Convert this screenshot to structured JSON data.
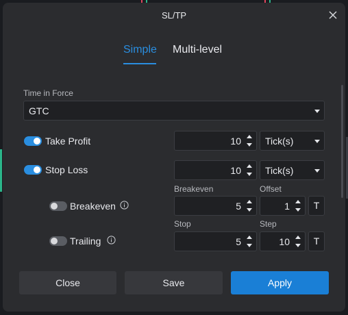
{
  "dialog": {
    "title": "SL/TP"
  },
  "tabs": [
    {
      "label": "Simple",
      "active": true
    },
    {
      "label": "Multi-level",
      "active": false
    }
  ],
  "time_in_force": {
    "label": "Time in Force",
    "value": "GTC"
  },
  "take_profit": {
    "label": "Take Profit",
    "enabled": true,
    "value": "10",
    "unit": "Tick(s)"
  },
  "stop_loss": {
    "label": "Stop Loss",
    "enabled": true,
    "value": "10",
    "unit": "Tick(s)"
  },
  "breakeven": {
    "label": "Breakeven",
    "enabled": false,
    "value_label": "Breakeven",
    "value": "5",
    "offset_label": "Offset",
    "offset": "1",
    "unit_button": "T"
  },
  "trailing": {
    "label": "Trailing",
    "enabled": false,
    "stop_label": "Stop",
    "stop": "5",
    "step_label": "Step",
    "step": "10",
    "unit_button": "T"
  },
  "footer": {
    "close": "Close",
    "save": "Save",
    "apply": "Apply"
  },
  "colors": {
    "accent": "#2a8ee0",
    "apply_button": "#1a7fd6",
    "dialog_bg": "#2b2c2f",
    "field_bg": "#1f2023"
  },
  "icons": {
    "close": "close-icon",
    "info": "info-icon",
    "dropdown": "chevron-down-icon",
    "spinner": "spinner-arrows-icon"
  }
}
